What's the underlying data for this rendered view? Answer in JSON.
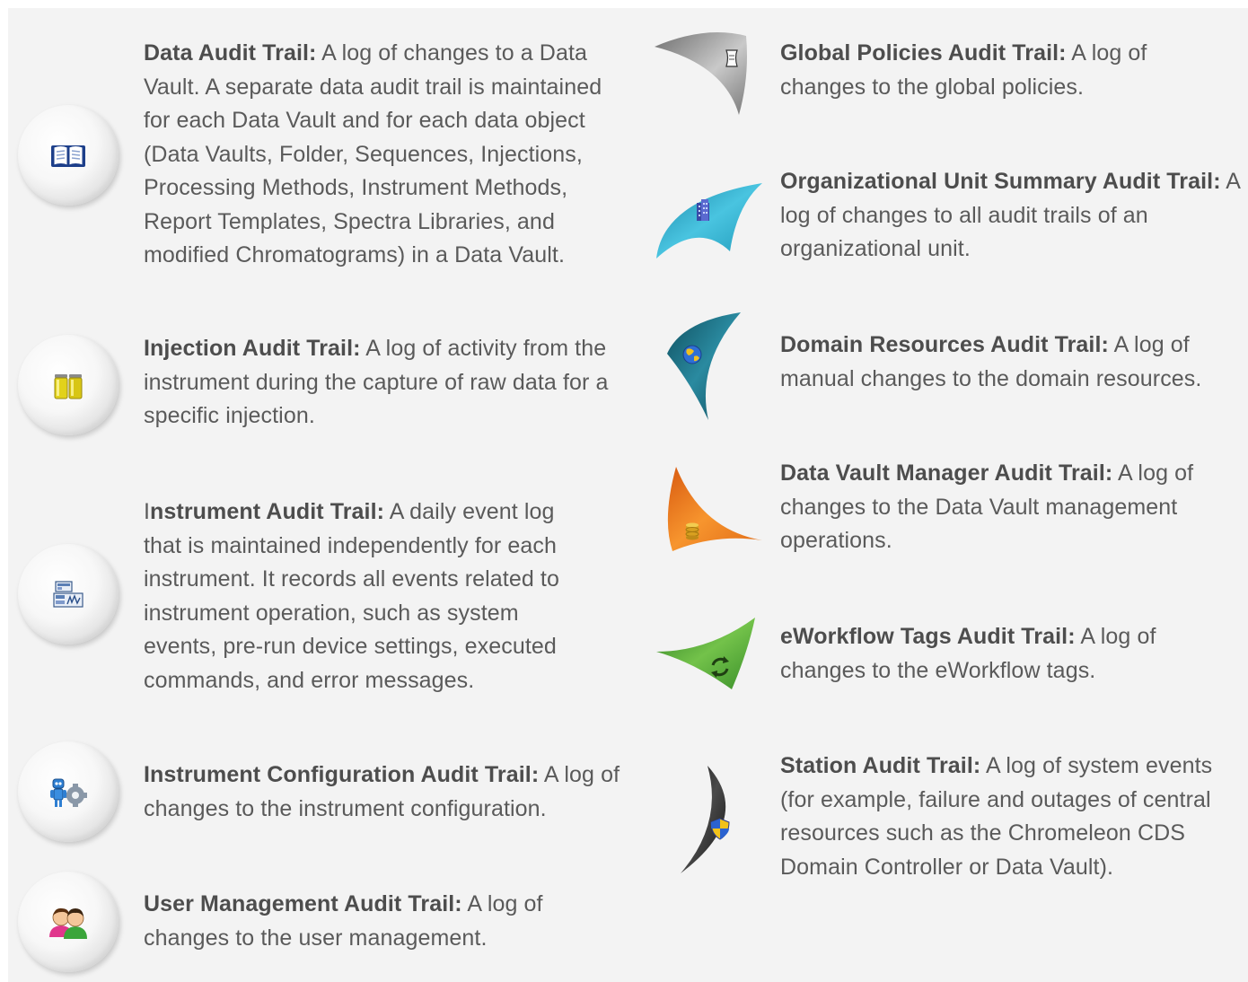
{
  "left": [
    {
      "title": "Data Audit Trail:",
      "body": " A log of changes to a Data Vault. A separate data audit trail is maintained for each Data Vault and for each data object (Data Vaults, Folder, Sequences, Injections, Processing Methods, Instrument Methods, Report Templates, Spectra Libraries, and modified Chromatograms) in a Data Vault.",
      "icon": "book-icon"
    },
    {
      "title": "Injection Audit Trail:",
      "body": " A log of activity from the instrument during the capture of raw data for a specific injection.",
      "icon": "vials-icon"
    },
    {
      "prefix": "I",
      "title": "nstrument Audit Trail:",
      "body": " A daily event log that is maintained independently for each instrument. It records all events related to instrument operation, such as system events, pre-run device settings, executed commands, and error messages.",
      "icon": "instrument-icon"
    },
    {
      "title": "Instrument Configuration Audit Trail:",
      "body": " A log of changes to the instrument configuration.",
      "icon": "robot-gear-icon"
    },
    {
      "title": "User Management Audit Trail:",
      "body": " A log of changes to the user management.",
      "icon": "users-icon"
    }
  ],
  "right": [
    {
      "title": "Global Policies Audit Trail:",
      "body": " A log of changes to the global policies.",
      "icon": "scroll-icon",
      "color": "#9a9a9a"
    },
    {
      "title": "Organizational Unit Summary Audit Trail:",
      "body": " A log of changes to all audit trails of an organizational unit.",
      "icon": "building-icon",
      "color": "#3fb2cf"
    },
    {
      "title": "Domain Resources Audit Trail:",
      "body": " A log of manual changes to the domain resources.",
      "icon": "globe-icon",
      "color": "#1c6a7c"
    },
    {
      "title": "Data Vault Manager Audit Trail:",
      "body": " A log of changes to the Data Vault management operations.",
      "icon": "database-icon",
      "color": "#ee7a22"
    },
    {
      "title": "eWorkflow Tags Audit Trail:",
      "body": " A log of changes to the eWorkflow tags.",
      "icon": "recycle-arrows-icon",
      "color": "#4ea835"
    },
    {
      "title": "Station Audit Trail:",
      "body": " A log of system events (for example, failure and outages of central resources such as the Chromeleon CDS Domain Controller or Data Vault).",
      "icon": "shield-icon",
      "color": "#2b2b2b"
    }
  ]
}
